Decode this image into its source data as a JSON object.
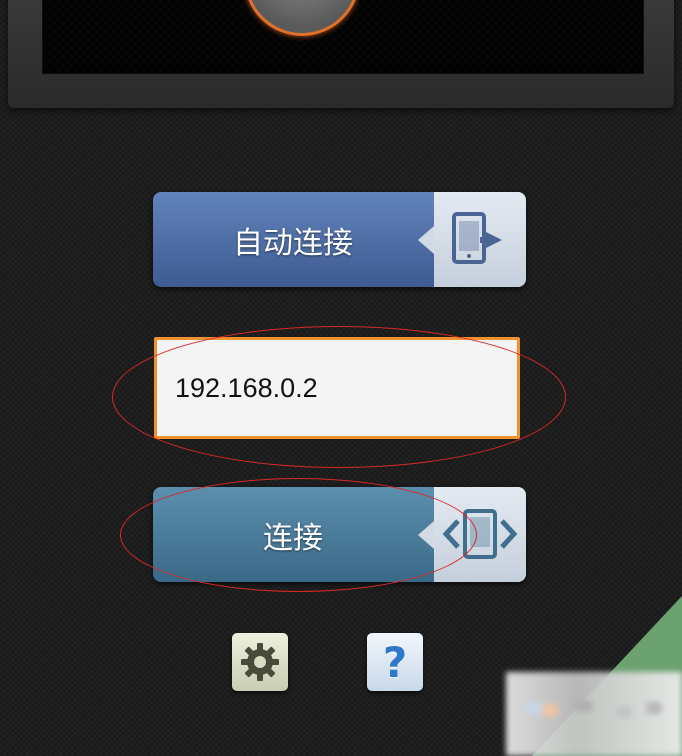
{
  "auto_connect_button": {
    "label": "自动连接"
  },
  "ip_field": {
    "value": "192.168.0.2"
  },
  "connect_button": {
    "label": "连接"
  },
  "help_button": {
    "glyph": "?"
  },
  "icons": {
    "top_knob": "speaker-knob-icon",
    "auto_connect": "phone-arrow-right-icon",
    "connect": "phone-bidirectional-icon",
    "settings": "gear-icon",
    "help": "question-mark-icon"
  },
  "colors": {
    "auto_connect_bg": "#4f6ea8",
    "connect_bg": "#4b7d9b",
    "ip_border": "#f0912f",
    "annotation_red": "#d72828",
    "corner_green": "#6ca170",
    "help_blue": "#2f79c8"
  }
}
